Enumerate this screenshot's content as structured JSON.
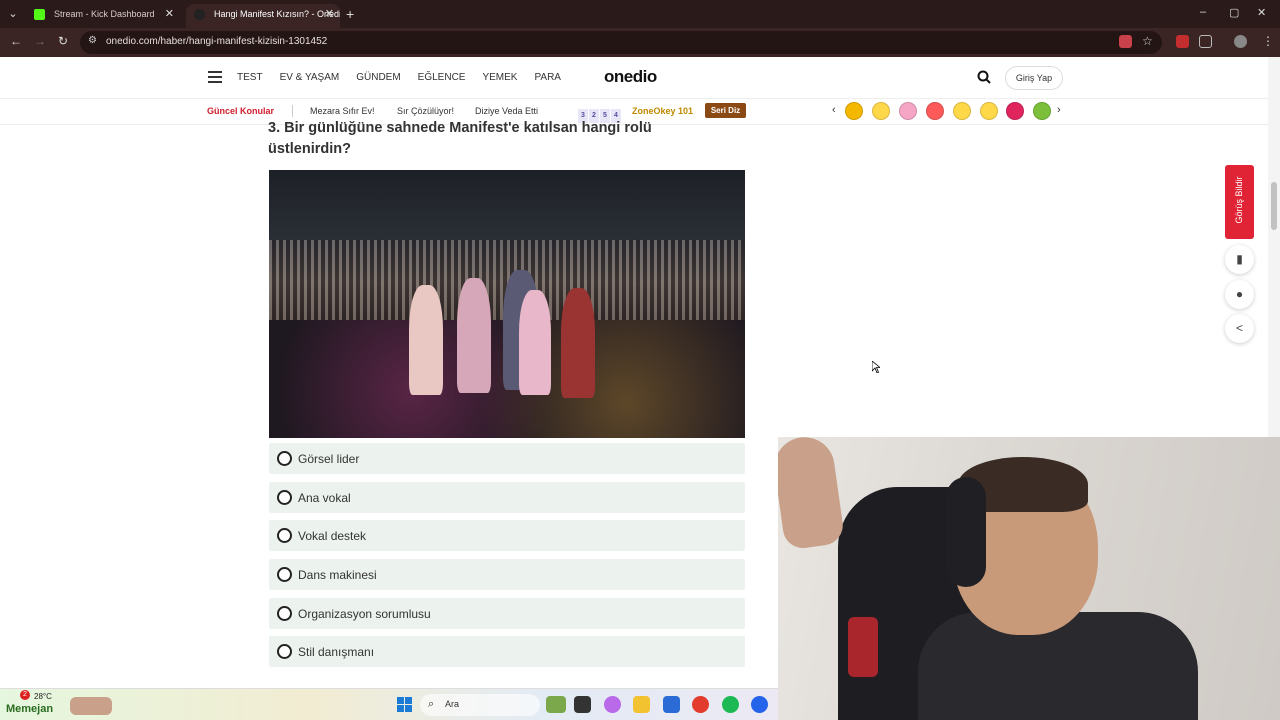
{
  "browser": {
    "tabs": [
      {
        "title": "Stream - Kick Dashboard",
        "favicon_color": "#53fc18",
        "active": false
      },
      {
        "title": "Hangi Manifest Kızısın? - Onedio",
        "favicon_color": "#222222",
        "active": true
      }
    ],
    "new_tab_label": "+",
    "url": "onedio.com/haber/hangi-manifest-kizisin-1301452",
    "window_controls": [
      "–",
      "▢",
      "✕"
    ]
  },
  "site": {
    "logo": "onedio",
    "nav": [
      "TEST",
      "EV & YAŞAM",
      "GÜNDEM",
      "EĞLENCE",
      "YEMEK",
      "PARA"
    ],
    "login_label": "Giriş Yap",
    "hot_label": "Güncel Konular",
    "hot_links": [
      "Mezara Sıfır Ev!",
      "Sır Çözülüyor!",
      "Diziye Veda Etti"
    ],
    "zone_digits": [
      "3",
      "2",
      "5",
      "4"
    ],
    "zone_label": "ZoneOkey 101",
    "seri_label": "Seri Diz",
    "emoji_colors": [
      "#f5b800",
      "#ffd84a",
      "#f4a6c4",
      "#ff5a5a",
      "#ffd84a",
      "#ffd84a",
      "#e0245e",
      "#7bbf3a"
    ]
  },
  "question": {
    "title": "3. Bir günlüğüne sahnede Manifest'e katılsan hangi rolü üstlenirdin?",
    "options": [
      "Görsel lider",
      "Ana vokal",
      "Vokal destek",
      "Dans makinesi",
      "Organizasyon sorumlusu",
      "Stil danışmanı"
    ]
  },
  "side": {
    "feedback_label": "Görüş Bildir",
    "icons": [
      "bookmark-icon",
      "comments-icon",
      "share-icon"
    ]
  },
  "taskbar": {
    "notification_count": "2",
    "temperature": "28°C",
    "widget_label": "Memejan",
    "search_label": "Ara",
    "app_colors": [
      "#7aa84a",
      "#333333",
      "#b86ae8",
      "#f2c230",
      "#2a6bd6",
      "#e33b2e",
      "#1db954",
      "#2563eb"
    ]
  }
}
